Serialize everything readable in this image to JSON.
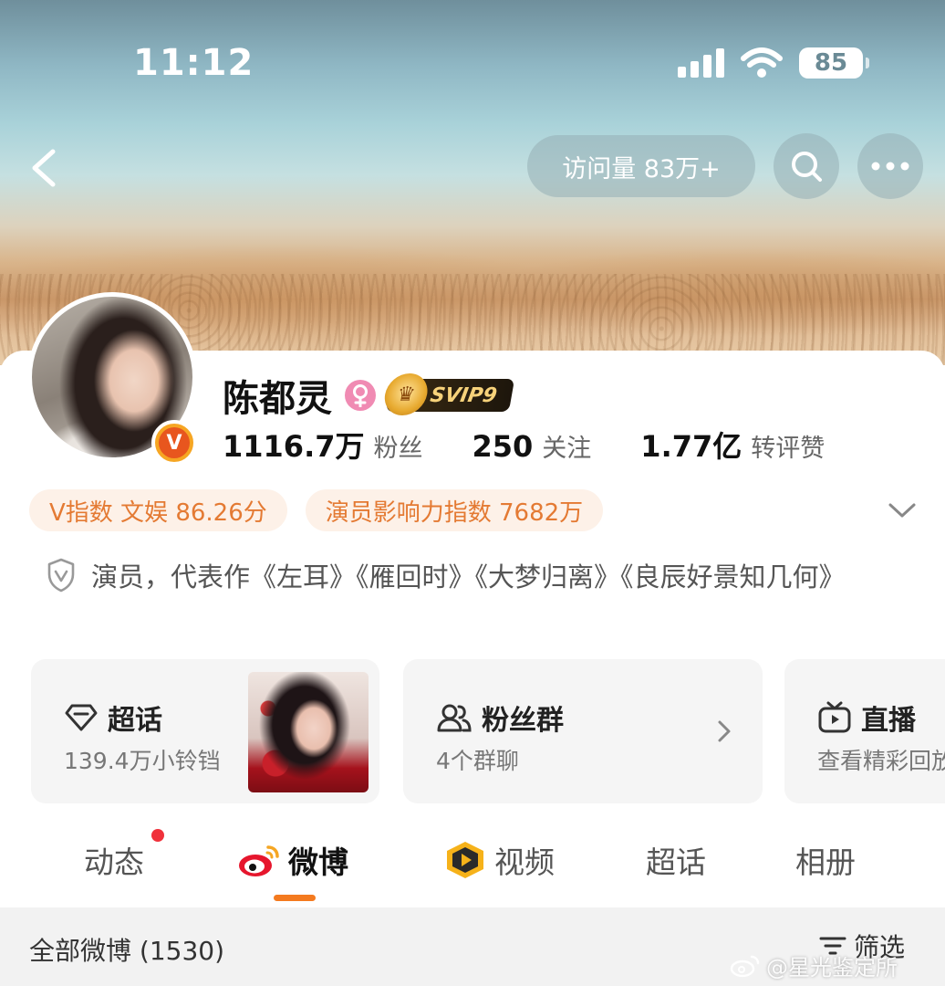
{
  "status_bar": {
    "time": "11:12",
    "battery": "85"
  },
  "nav": {
    "visits": "访问量 83万+"
  },
  "profile": {
    "name": "陈都灵",
    "gender": "female",
    "vip_badge": "SVIP9",
    "verify_mark": "V",
    "stats": [
      {
        "number": "1116.7万",
        "label": "粉丝"
      },
      {
        "number": "250",
        "label": "关注"
      },
      {
        "number": "1.77亿",
        "label": "转评赞"
      }
    ],
    "tags": [
      "V指数 文娱 86.26分",
      "演员影响力指数 7682万"
    ],
    "bio": "演员，代表作《左耳》《雁回时》《大梦归离》《良辰好景知几何》"
  },
  "features": {
    "chaohua": {
      "title": "超话",
      "subtitle": "139.4万小铃铛"
    },
    "fans_group": {
      "title": "粉丝群",
      "subtitle": "4个群聊"
    },
    "live": {
      "title": "直播",
      "subtitle": "查看精彩回放"
    }
  },
  "tabs": [
    "动态",
    "微博",
    "视频",
    "超话",
    "相册"
  ],
  "active_tab": "微博",
  "filter_bar": {
    "title": "全部微博 (1530)",
    "filter_label": "筛选"
  },
  "watermark": "@星光鉴定所",
  "colors": {
    "accent_orange": "#f47a1f",
    "tag_text": "#e47a33",
    "tag_bg": "#fdf1e8",
    "notification_dot": "#f0313b"
  }
}
